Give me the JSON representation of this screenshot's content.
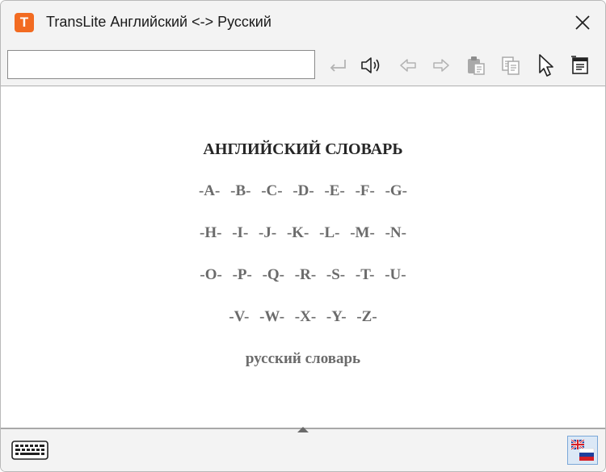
{
  "window": {
    "title": "TransLite Английский <-> Русский",
    "app_icon_letter": "T",
    "accent_color": "#f26b21"
  },
  "toolbar": {
    "search_value": "",
    "icons": [
      "enter-icon",
      "speaker-icon",
      "back-arrow-icon",
      "forward-arrow-icon",
      "paste-icon",
      "copy-icon",
      "pointer-icon",
      "dictionary-list-icon"
    ]
  },
  "content": {
    "title": "АНГЛИЙСКИЙ СЛОВАРЬ",
    "rows": [
      [
        "-A-",
        "-B-",
        "-C-",
        "-D-",
        "-E-",
        "-F-",
        "-G-"
      ],
      [
        "-H-",
        "-I-",
        "-J-",
        "-K-",
        "-L-",
        "-M-",
        "-N-"
      ],
      [
        "-O-",
        "-P-",
        "-Q-",
        "-R-",
        "-S-",
        "-T-",
        "-U-"
      ],
      [
        "-V-",
        "-W-",
        "-X-",
        "-Y-",
        "-Z-"
      ]
    ],
    "russian_link": "русский словарь"
  },
  "bottom": {
    "icons": [
      "keyboard-icon",
      "uk-ru-flag-icon"
    ]
  }
}
